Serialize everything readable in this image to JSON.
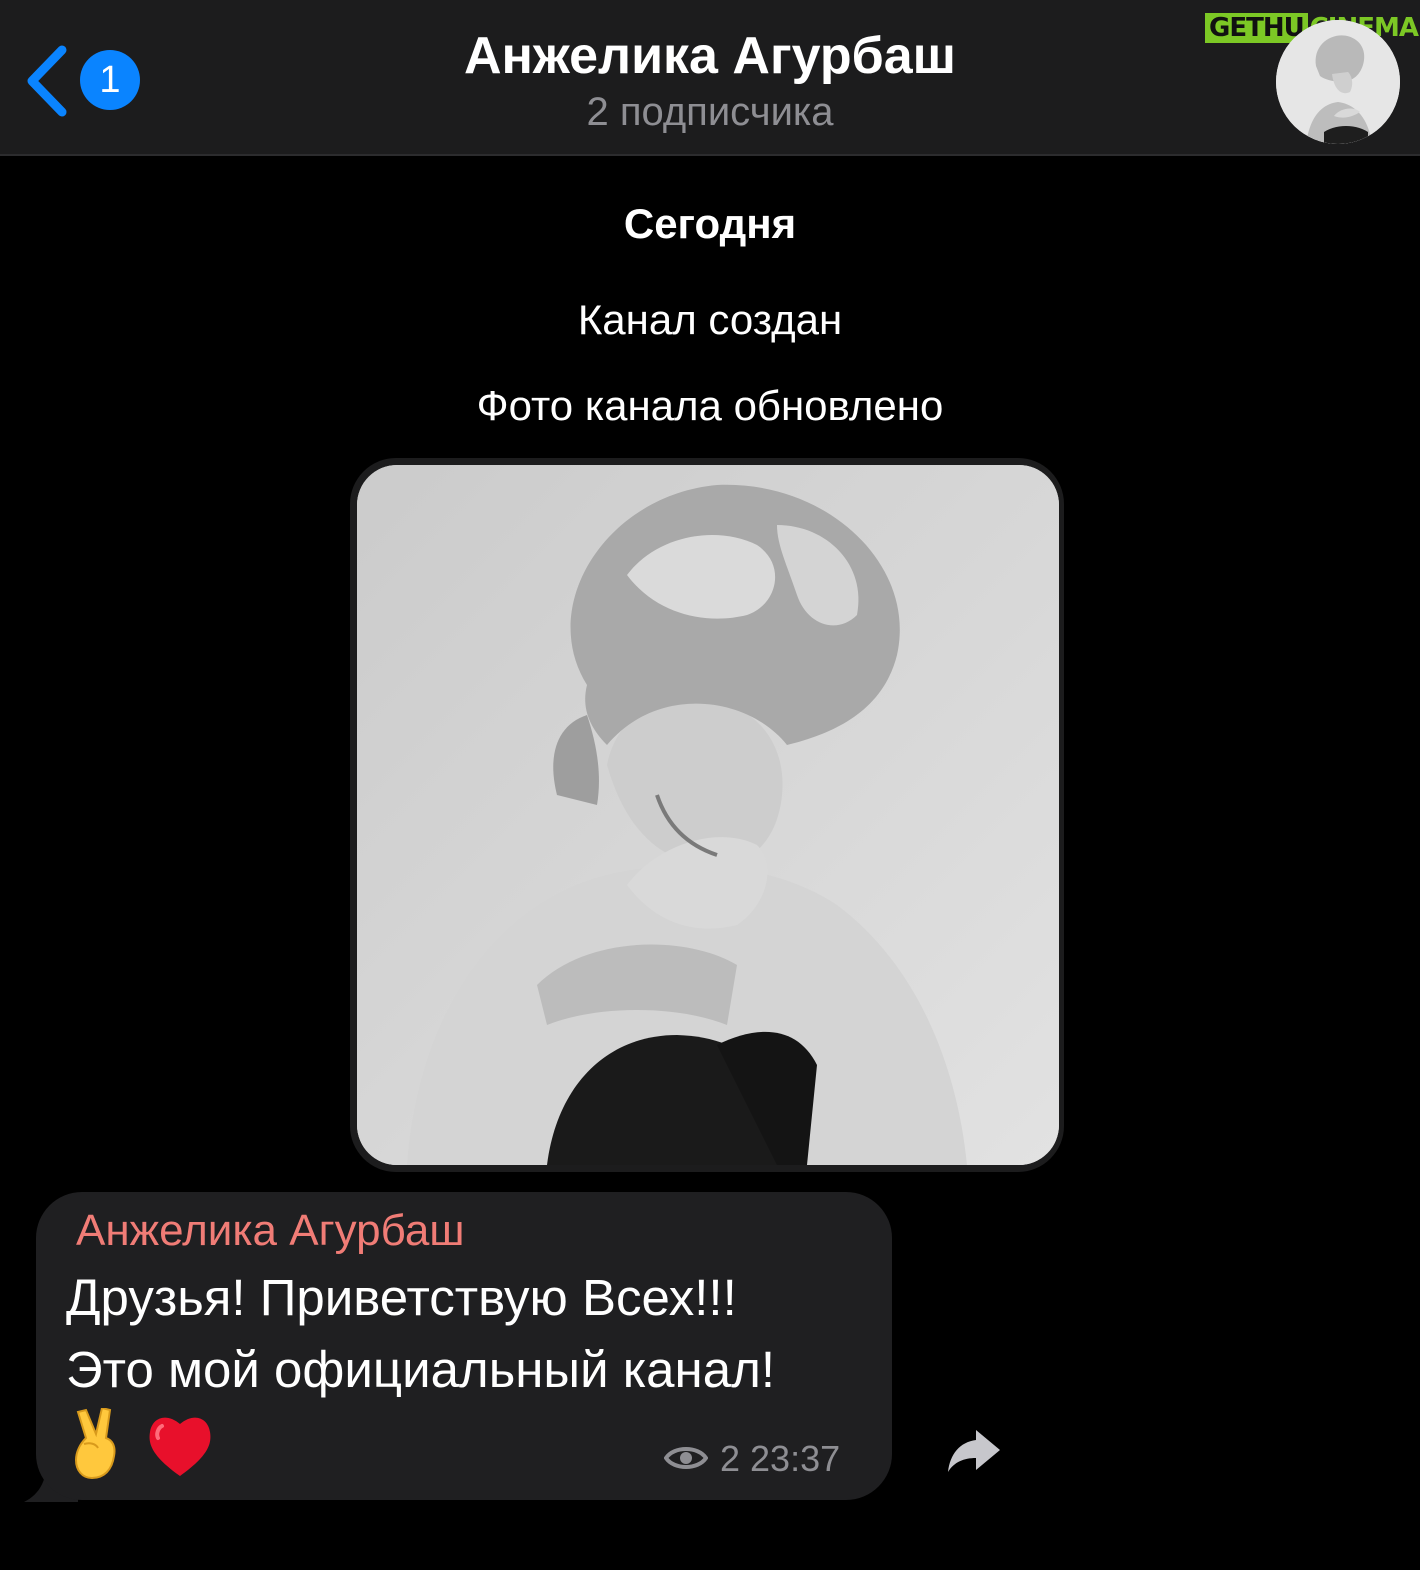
{
  "header": {
    "unread_count": "1",
    "channel_title": "Анжелика Агурбаш",
    "subscribers": "2 подписчика",
    "watermark_left": "GETHU",
    "watermark_right": "CINEMA",
    "back_icon": "chevron-left-icon",
    "accent_color": "#0a84ff"
  },
  "feed": {
    "date_label": "Сегодня",
    "service_created": "Канал создан",
    "service_photo_updated": "Фото канала обновлено"
  },
  "message": {
    "sender": "Анжелика Агурбаш",
    "sender_color": "#f07c76",
    "line1": "Друзья! Приветствую Всех!!!",
    "line2": "Это мой официальный канал!",
    "emoji": [
      "victory-hand",
      "red-heart"
    ],
    "views": "2",
    "time": "23:37",
    "meta_text": "2 23:37"
  }
}
